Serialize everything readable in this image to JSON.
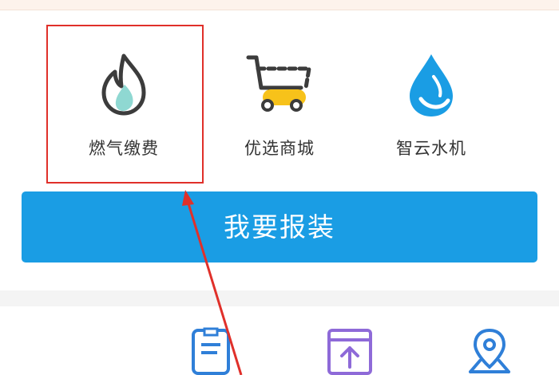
{
  "services": {
    "gas": {
      "label": "燃气缴费",
      "icon": "flame-icon"
    },
    "mall": {
      "label": "优选商城",
      "icon": "shopping-cart-icon"
    },
    "water": {
      "label": "智云水机",
      "icon": "water-drop-icon"
    }
  },
  "install_button": {
    "label": "我要报装"
  },
  "bottom_icons": [
    "document-edit-icon",
    "upload-window-icon",
    "map-pin-icon"
  ],
  "colors": {
    "primary": "#1a9de4",
    "highlight_annotation": "#e0302a",
    "cart_accent": "#f7c21a",
    "flame_fill": "#8fd8d2",
    "icon_dark": "#3c3c3c",
    "bottom_icon": "#2f7fd8",
    "upload_icon": "#8e6ad8"
  }
}
